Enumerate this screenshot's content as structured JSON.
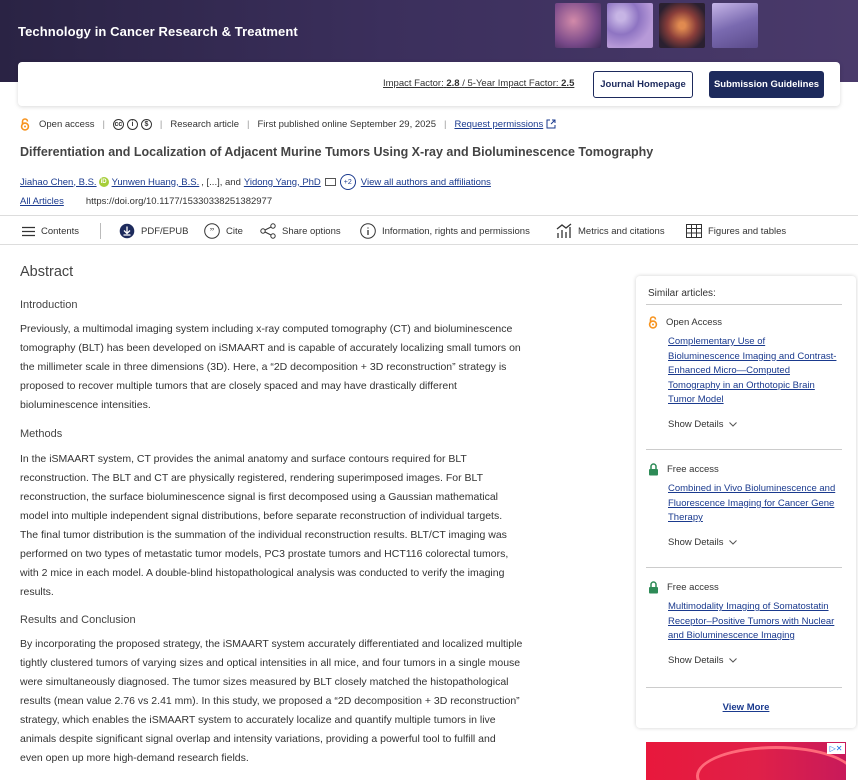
{
  "header": {
    "journal_title": "Technology in Cancer Research & Treatment",
    "impact_label": "Impact Factor:",
    "impact_value": "2.8",
    "impact_sep": "/",
    "five_year_label": "5-Year Impact Factor:",
    "five_year_value": "2.5",
    "journal_homepage": "Journal Homepage",
    "submission_guidelines": "Submission Guidelines"
  },
  "meta": {
    "access": "Open access",
    "license_icons": [
      "cc",
      "by",
      "nc"
    ],
    "article_type": "Research article",
    "published": "First published online September 29, 2025",
    "permissions": "Request permissions"
  },
  "article": {
    "title": "Differentiation and Localization of Adjacent Murine Tumors Using X-ray and Bioluminescence Tomography",
    "author1": "Jiahao Chen, B.S.",
    "author2": "Yunwen Huang, B.S.",
    "ellipsis": ", [...], and",
    "author3": "Yidong Yang, PhD",
    "more_count": "+2",
    "all_authors": "View all authors and affiliations",
    "all_articles": "All Articles",
    "doi": "https://doi.org/10.1177/15330338251382977"
  },
  "toolbar": {
    "contents": "Contents",
    "pdf": "PDF/EPUB",
    "cite": "Cite",
    "share": "Share options",
    "info": "Information, rights and permissions",
    "metrics": "Metrics and citations",
    "figures": "Figures and tables"
  },
  "abstract": {
    "heading": "Abstract",
    "intro_h": "Introduction",
    "intro": [
      "Previously, a multimodal imaging system including x-ray computed tomography (CT) and bioluminescence",
      "tomography (BLT) has been developed on iSMAART and is capable of accurately localizing small tumors on",
      "the millimeter scale in three dimensions (3D). Here, a “2D decomposition + 3D reconstruction” strategy is",
      "proposed to recover multiple tumors that are closely spaced and may have drastically different",
      "bioluminescence intensities."
    ],
    "methods_h": "Methods",
    "methods": [
      "In the iSMAART system, CT provides the animal anatomy and surface contours required for BLT",
      "reconstruction. The BLT and CT are physically registered, rendering superimposed images. For BLT",
      "reconstruction, the surface bioluminescence signal is first decomposed using a Gaussian mathematical",
      "model into multiple independent signal distributions, before separate reconstruction of individual targets.",
      "The final tumor distribution is the summation of the individual reconstruction results. BLT/CT imaging was",
      "performed on two types of metastatic tumor models, PC3 prostate tumors and HCT116 colorectal tumors,",
      "with 2 mice in each model. A double-blind histopathological analysis was conducted to verify the imaging",
      "results."
    ],
    "results_h": "Results and Conclusion",
    "results": [
      "By incorporating the proposed strategy, the iSMAART system accurately differentiated and localized multiple",
      "tightly clustered tumors of varying sizes and optical intensities in all mice, and four tumors in a single mouse",
      "were simultaneously diagnosed. The tumor sizes measured by BLT closely matched the histopathological",
      "results (mean value 2.76 vs 2.41 mm). In this study, we proposed a “2D decomposition + 3D reconstruction”",
      "strategy, which enables the iSMAART system to accurately localize and quantify multiple tumors in live",
      "animals despite significant signal overlap and intensity variations, providing a powerful tool to fulfill and",
      "even open up more high-demand research fields."
    ]
  },
  "similar": {
    "heading": "Similar articles:",
    "show_details": "Show Details",
    "view_more": "View More",
    "items": [
      {
        "access": "Open Access",
        "lines": [
          "Complementary Use of",
          "Bioluminescence Imaging and Contrast-",
          "Enhanced Micro—Computed",
          "Tomography in an Orthotopic Brain",
          "Tumor Model"
        ]
      },
      {
        "access": "Free access",
        "lines": [
          "Combined in Vivo Bioluminescence and",
          "Fluorescence Imaging for Cancer Gene",
          "Therapy"
        ]
      },
      {
        "access": "Free access",
        "lines": [
          "Multimodality Imaging of Somatostatin",
          "Receptor–Positive Tumors with Nuclear",
          "and Bioluminescence Imaging"
        ]
      }
    ]
  },
  "colors": {
    "header_bg": "#2a2344",
    "brand_navy": "#1d2a5c",
    "link": "#1a3a8e",
    "open_access_orange": "#f7931e",
    "free_access_green": "#2e8b57"
  }
}
